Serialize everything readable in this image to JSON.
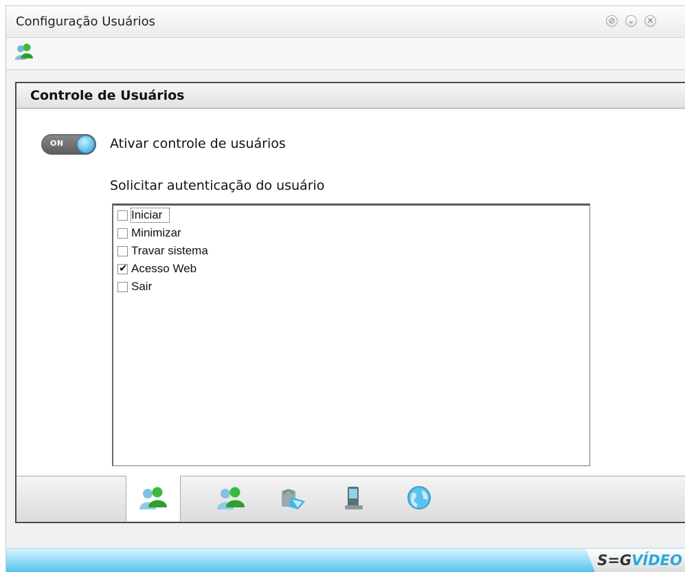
{
  "window": {
    "title": "Configuração Usuários",
    "controls": [
      "pin-icon",
      "minimize-icon",
      "close-icon"
    ]
  },
  "toolbar": {
    "icon": "users-icon"
  },
  "panel": {
    "title": "Controle de Usuários",
    "toggle": {
      "state_text": "ON",
      "label": "Ativar controle de usuários",
      "on": true
    },
    "auth_label": "Solicitar autenticação do usuário",
    "options": [
      {
        "label": "Iniciar",
        "checked": false
      },
      {
        "label": "Minimizar",
        "checked": false
      },
      {
        "label": "Travar sistema",
        "checked": false
      },
      {
        "label": "Acesso Web",
        "checked": true
      },
      {
        "label": "Sair",
        "checked": false
      }
    ]
  },
  "tabs": [
    {
      "icon": "users-icon",
      "active": true
    },
    {
      "icon": "users-icon",
      "active": false
    },
    {
      "icon": "network-lock-icon",
      "active": false
    },
    {
      "icon": "pda-device-icon",
      "active": false
    },
    {
      "icon": "globe-icon",
      "active": false
    }
  ],
  "footer": {
    "brand_part1": "S=G",
    "brand_part2": "VÍDEO"
  },
  "colors": {
    "accent": "#56c3ef",
    "toggle_knob": "#5fc2ec",
    "user_green": "#3cb83c"
  }
}
